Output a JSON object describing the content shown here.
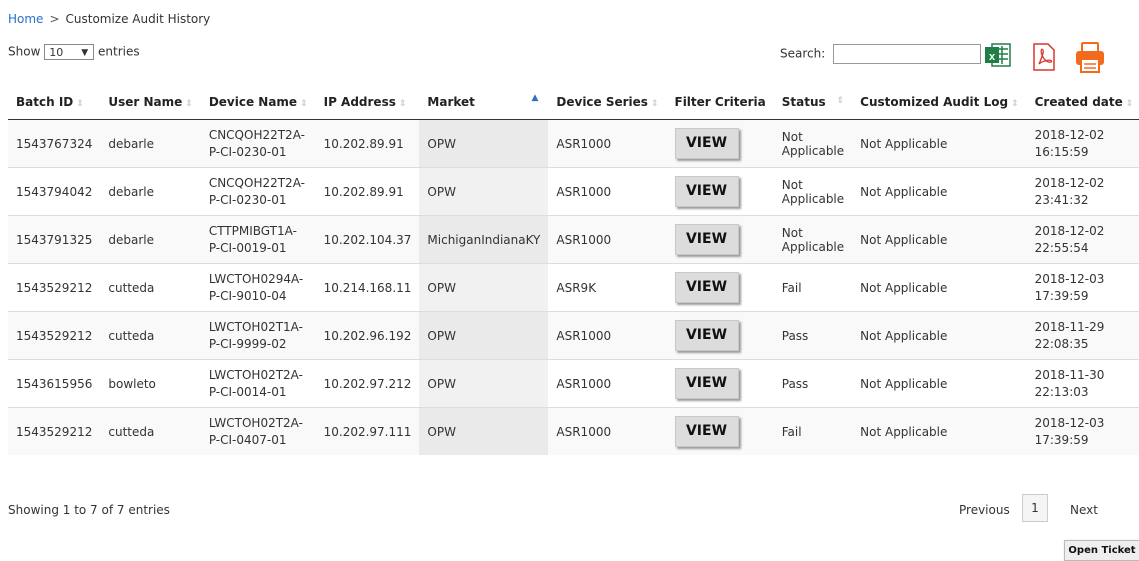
{
  "breadcrumb": {
    "home": "Home",
    "separator": ">",
    "current": "Customize Audit History"
  },
  "length": {
    "show": "Show",
    "value": "10",
    "entries": "entries"
  },
  "search": {
    "label": "Search:",
    "value": ""
  },
  "toolbar": {
    "excel_icon": "excel-icon",
    "pdf_icon": "pdf-icon",
    "print_icon": "print-icon"
  },
  "columns": [
    "Batch ID",
    "User Name",
    "Device Name",
    "IP Address",
    "Market",
    "Device Series",
    "Filter Criteria",
    "Status",
    "Customized Audit Log",
    "Created date"
  ],
  "rows": [
    {
      "batch_id": "1543767324",
      "user": "debarle",
      "device1": "CNCQOH22T2A-",
      "device2": "P-CI-0230-01",
      "ip": "10.202.89.91",
      "market": "OPW",
      "series": "ASR1000",
      "filter": "VIEW",
      "status": "Not Applicable",
      "log": "Not Applicable",
      "date": "2018-12-02",
      "time": "16:15:59"
    },
    {
      "batch_id": "1543794042",
      "user": "debarle",
      "device1": "CNCQOH22T2A-",
      "device2": "P-CI-0230-01",
      "ip": "10.202.89.91",
      "market": "OPW",
      "series": "ASR1000",
      "filter": "VIEW",
      "status": "Not Applicable",
      "log": "Not Applicable",
      "date": "2018-12-02",
      "time": "23:41:32"
    },
    {
      "batch_id": "1543791325",
      "user": "debarle",
      "device1": "CTTPMIBGT1A-",
      "device2": "P-CI-0019-01",
      "ip": "10.202.104.37",
      "market": "MichiganIndianaKY",
      "series": "ASR1000",
      "filter": "VIEW",
      "status": "Not Applicable",
      "log": "Not Applicable",
      "date": "2018-12-02",
      "time": "22:55:54"
    },
    {
      "batch_id": "1543529212",
      "user": "cutteda",
      "device1": "LWCTOH0294A-",
      "device2": "P-CI-9010-04",
      "ip": "10.214.168.11",
      "market": "OPW",
      "series": "ASR9K",
      "filter": "VIEW",
      "status": "Fail",
      "log": "Not Applicable",
      "date": "2018-12-03",
      "time": "17:39:59"
    },
    {
      "batch_id": "1543529212",
      "user": "cutteda",
      "device1": "LWCTOH02T1A-",
      "device2": "P-CI-9999-02",
      "ip": "10.202.96.192",
      "market": "OPW",
      "series": "ASR1000",
      "filter": "VIEW",
      "status": "Pass",
      "log": "Not Applicable",
      "date": "2018-11-29",
      "time": "22:08:35"
    },
    {
      "batch_id": "1543615956",
      "user": "bowleto",
      "device1": "LWCTOH02T2A-",
      "device2": "P-CI-0014-01",
      "ip": "10.202.97.212",
      "market": "OPW",
      "series": "ASR1000",
      "filter": "VIEW",
      "status": "Pass",
      "log": "Not Applicable",
      "date": "2018-11-30",
      "time": "22:13:03"
    },
    {
      "batch_id": "1543529212",
      "user": "cutteda",
      "device1": "LWCTOH02T2A-",
      "device2": "P-CI-0407-01",
      "ip": "10.202.97.111",
      "market": "OPW",
      "series": "ASR1000",
      "filter": "VIEW",
      "status": "Fail",
      "log": "Not Applicable",
      "date": "2018-12-03",
      "time": "17:39:59"
    }
  ],
  "footer": {
    "info": "Showing 1 to 7 of 7 entries",
    "previous": "Previous",
    "page": "1",
    "next": "Next"
  },
  "open_ticket": "Open Ticket"
}
